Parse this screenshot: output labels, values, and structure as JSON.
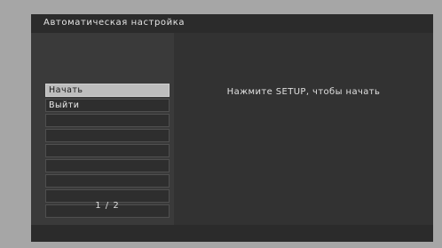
{
  "title": "Автоматическая настройка",
  "menu": {
    "items": [
      "Начать",
      "Выйти",
      "",
      "",
      "",
      "",
      "",
      "",
      ""
    ],
    "selected_index": 0
  },
  "page_indicator": "1 / 2",
  "message": "Нажмите SETUP, чтобы начать",
  "colors": {
    "background": "#a6a6a6",
    "screen": "#3a3a3a",
    "bar": "#2b2b2b",
    "selected_item": "#bdbdbd"
  }
}
